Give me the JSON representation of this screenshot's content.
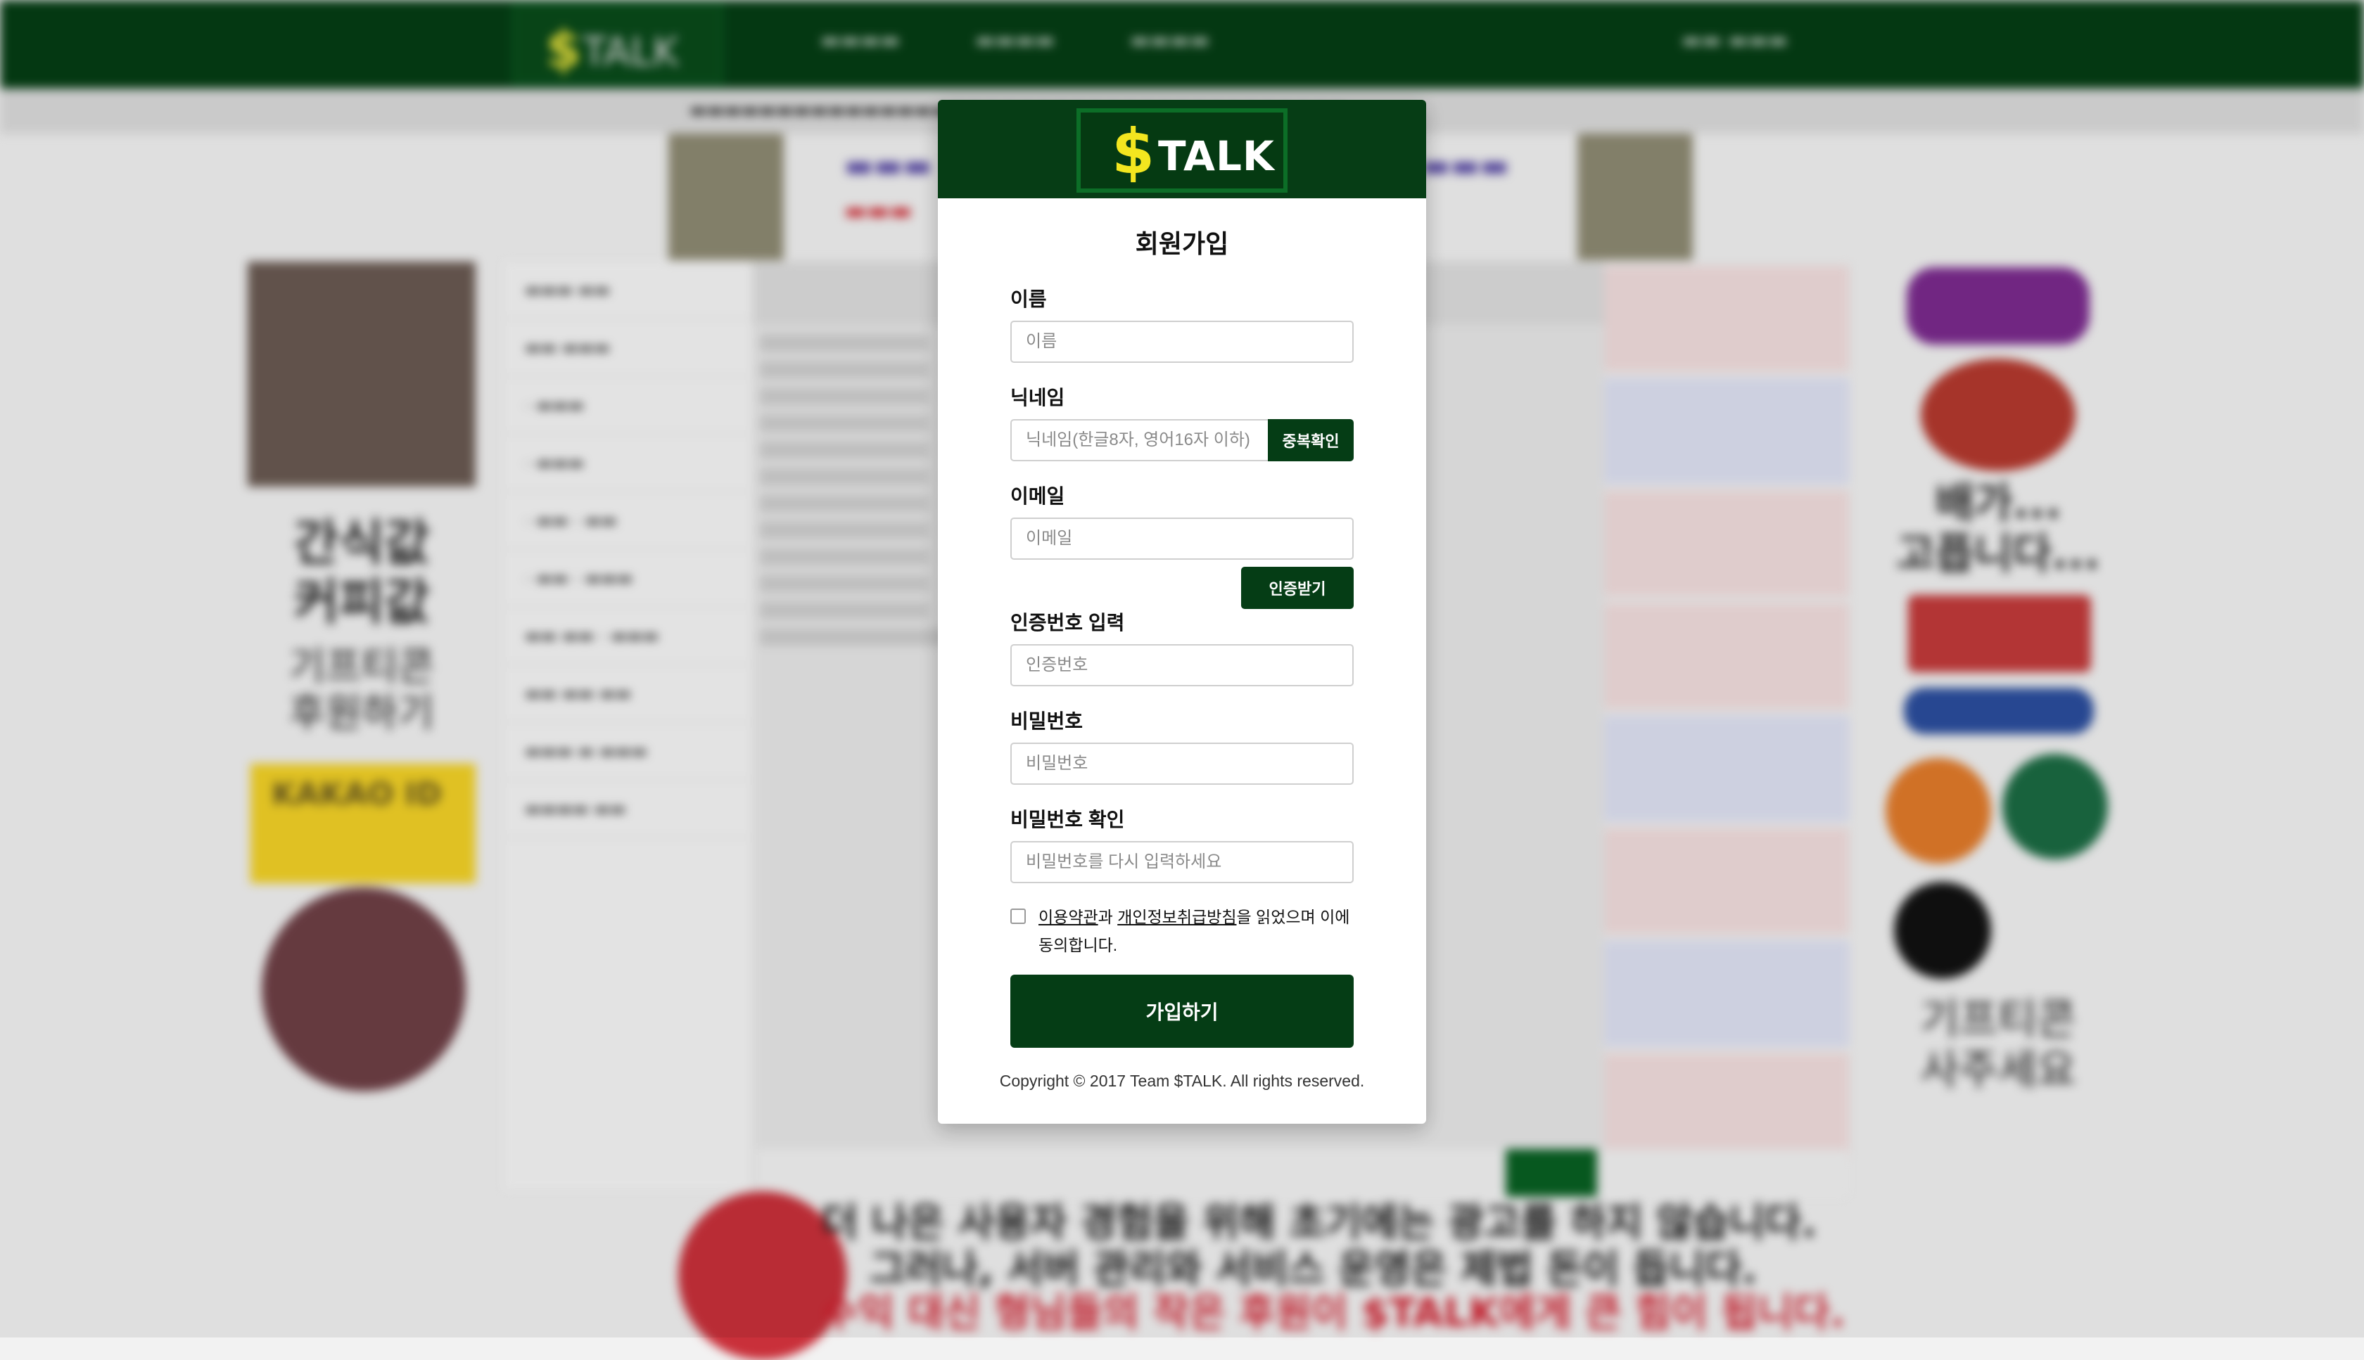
{
  "modal": {
    "logo_symbol": "$",
    "logo_text": "TALK",
    "title": "회원가입",
    "fields": {
      "name": {
        "label": "이름",
        "placeholder": "이름",
        "value": ""
      },
      "nickname": {
        "label": "닉네임",
        "placeholder": "닉네임(한글8자, 영어16자 이하)",
        "value": "",
        "check_button": "중복확인"
      },
      "email": {
        "label": "이메일",
        "placeholder": "이메일",
        "value": "",
        "verify_button": "인증받기"
      },
      "code": {
        "label": "인증번호 입력",
        "placeholder": "인증번호",
        "value": ""
      },
      "password": {
        "label": "비밀번호",
        "placeholder": "비밀번호",
        "value": ""
      },
      "password_confirm": {
        "label": "비밀번호 확인",
        "placeholder": "비밀번호를 다시 입력하세요",
        "value": ""
      }
    },
    "agreement": {
      "terms_link": "이용약관",
      "conj": "과 ",
      "privacy_link": "개인정보취급방침",
      "rest": "을 읽었으며 이에 동의합니다.",
      "checked": false
    },
    "submit_label": "가입하기",
    "copyright": "Copyright © 2017 Team $TALK. All rights reserved."
  },
  "background": {
    "left_promo_line1": "간식값",
    "left_promo_line2": "커피값",
    "left_promo_line3": "기프티콘",
    "left_promo_line4": "후원하기",
    "kakao_label": "KAKAO ID",
    "right_promo_line1": "배가...",
    "right_promo_line2": "고픕니다...",
    "right_promo_line3": "기프티콘",
    "right_promo_line4": "사주세요",
    "footer_line1": "더 나은 사용자 경험을 위해 초기에는 광고를 하지 않습니다.",
    "footer_line2": "그러나, 서버 관리와 서비스 운영은 제법 돈이 듭니다.",
    "footer_line3": "수익 대신 형님들의 작은 후원이 $TALK에게 큰 힘이 됩니다."
  },
  "colors": {
    "brand_green": "#053d15",
    "logo_yellow": "#f3e61f"
  }
}
